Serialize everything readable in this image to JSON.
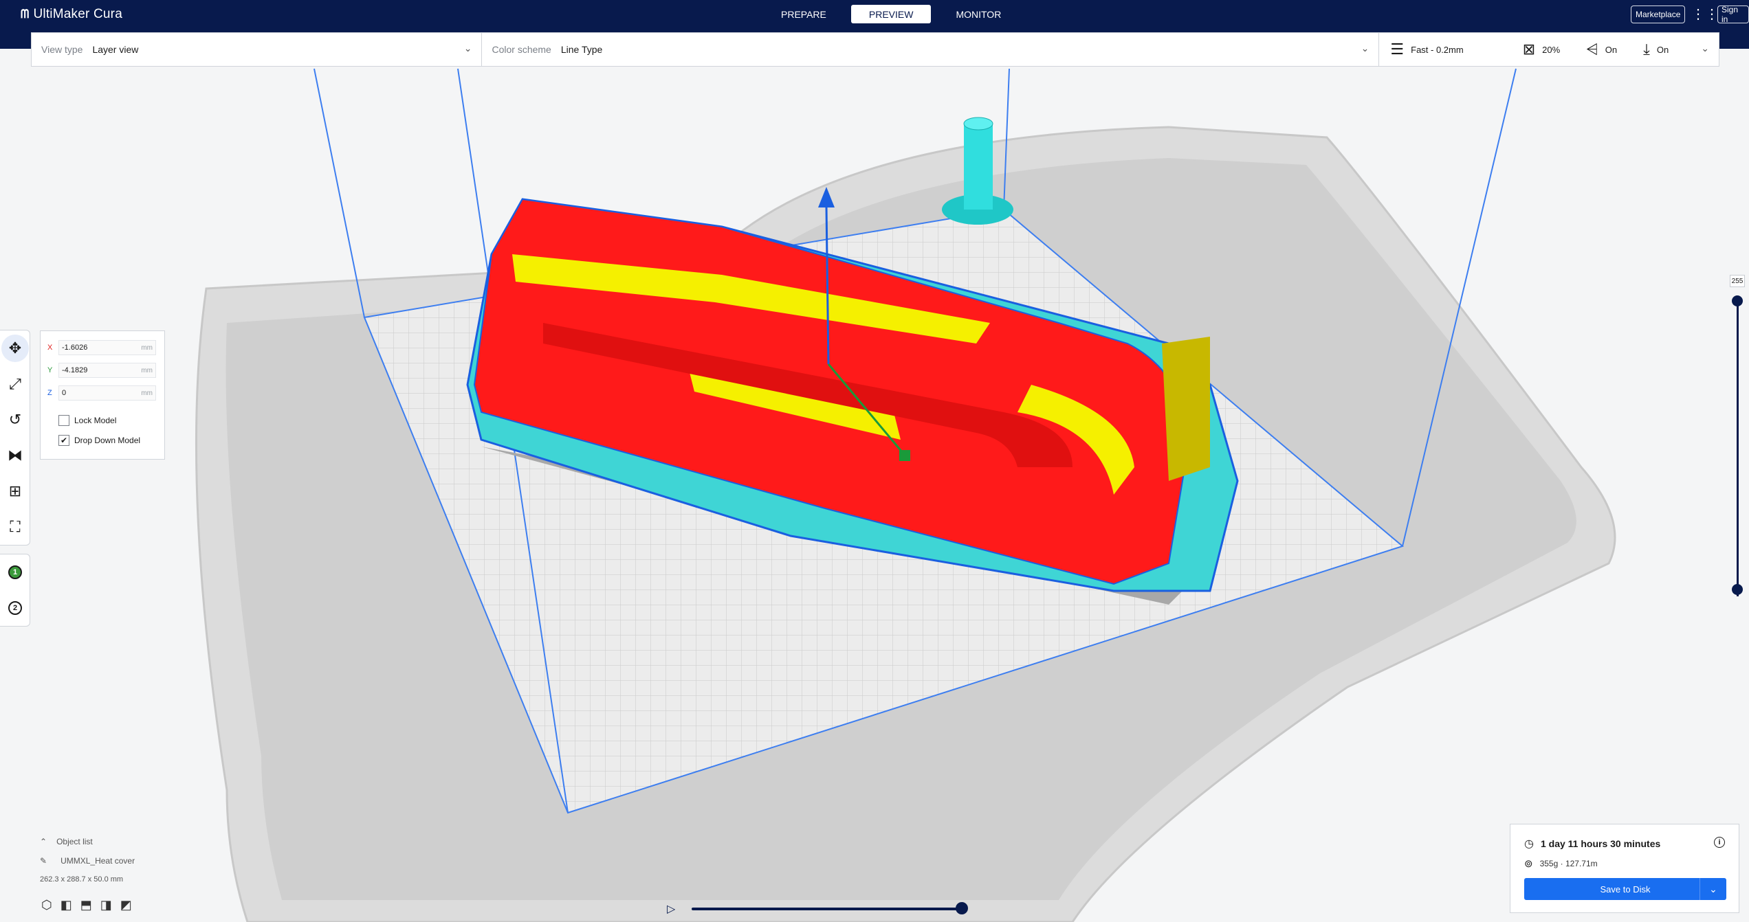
{
  "app": {
    "title": "UltiMaker Cura"
  },
  "stages": [
    {
      "label": "PREPARE",
      "active": false
    },
    {
      "label": "PREVIEW",
      "active": true
    },
    {
      "label": "MONITOR",
      "active": false
    }
  ],
  "header": {
    "marketplace": "Marketplace",
    "signin": "Sign in"
  },
  "viewbar": {
    "view_type_label": "View type",
    "view_type_value": "Layer view",
    "color_scheme_label": "Color scheme",
    "color_scheme_value": "Line Type",
    "profile": "Fast - 0.2mm",
    "infill": "20%",
    "support": "On",
    "adhesion": "On"
  },
  "move_panel": {
    "x_label": "X",
    "x_value": "-1.6026",
    "y_label": "Y",
    "y_value": "-4.1829",
    "z_label": "Z",
    "z_value": "0",
    "unit": "mm",
    "lock_model": "Lock Model",
    "drop_down_model": "Drop Down Model"
  },
  "object_list": {
    "title": "Object list",
    "object_name": "UMMXL_Heat cover",
    "dimensions": "262.3 x 288.7 x 50.0 mm"
  },
  "layer_slider": {
    "top_value": "255"
  },
  "print_panel": {
    "time": "1 day 11 hours 30 minutes",
    "material": "355g · 127.71m",
    "save_button": "Save to Disk"
  },
  "colors": {
    "header": "#081a4d",
    "accent": "#196ef0",
    "wall_outer": "#ff1a1a",
    "infill": "#f5f000",
    "support": "#39d4d4"
  }
}
